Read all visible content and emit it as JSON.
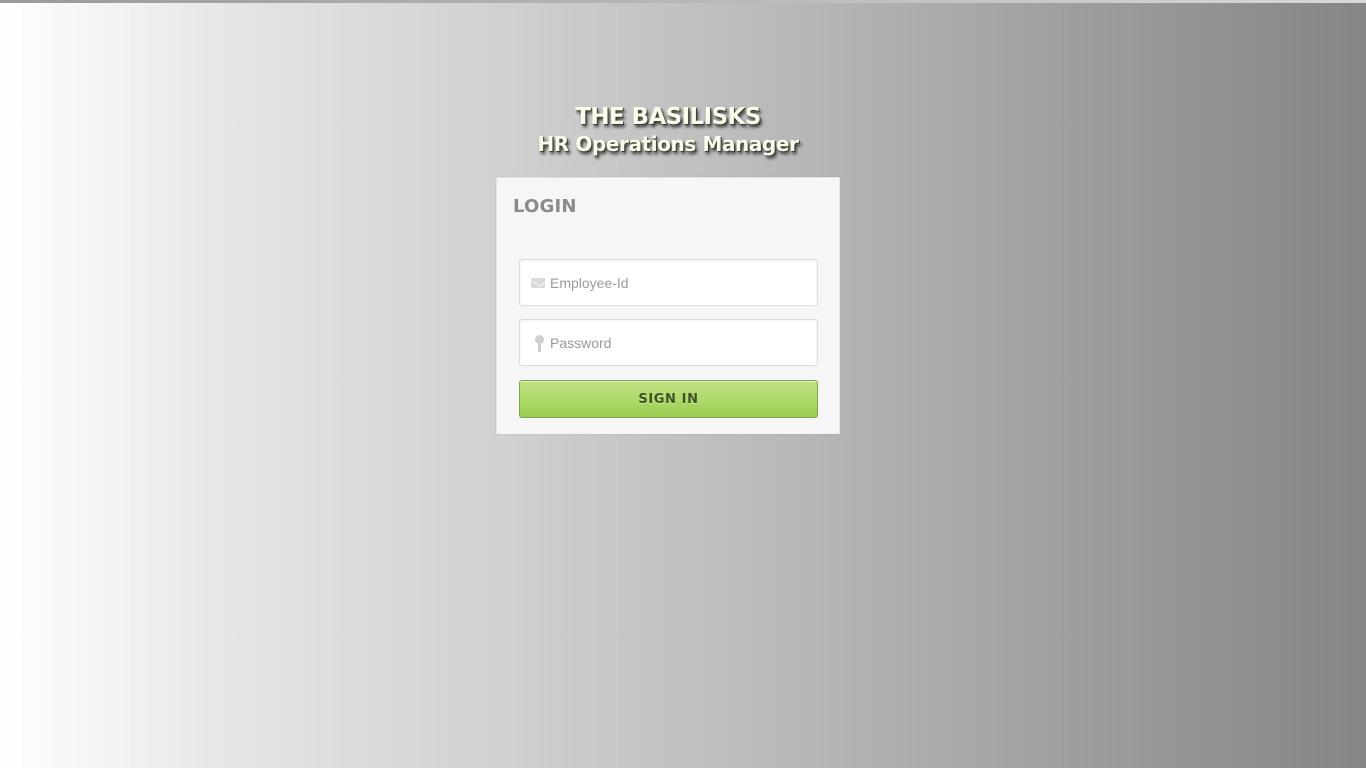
{
  "brand": {
    "title": "THE BASILISKS",
    "subtitle": "HR Operations Manager"
  },
  "login": {
    "heading": "LOGIN",
    "employee_id": {
      "placeholder": "Employee-Id",
      "value": "",
      "icon": "envelope-icon"
    },
    "password": {
      "placeholder": "Password",
      "value": "",
      "icon": "key-icon"
    },
    "submit_label": "SIGN IN"
  },
  "colors": {
    "button_green": "#addb6a",
    "button_text": "#3e5222",
    "panel_background": "#f6f6f6",
    "brand_text": "#fbfbec"
  }
}
